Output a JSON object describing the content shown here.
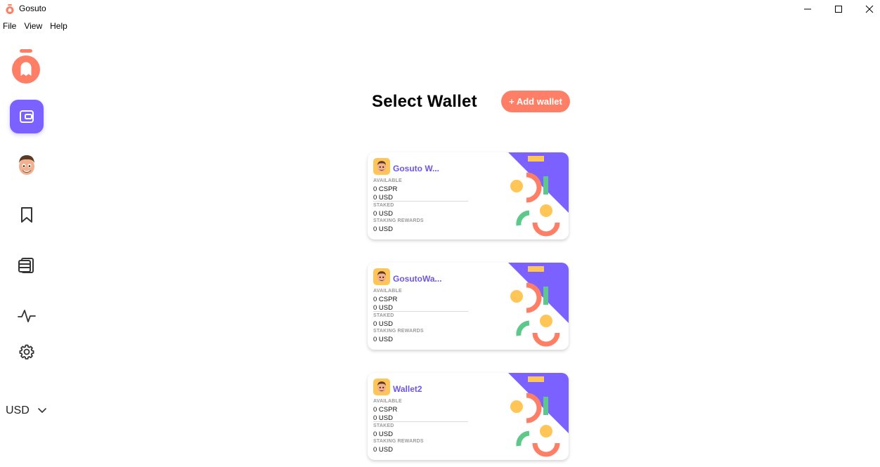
{
  "window": {
    "title": "Gosuto",
    "controls": [
      "minimize-icon",
      "maximize-icon",
      "close-icon"
    ]
  },
  "menu": {
    "file": "File",
    "view": "View",
    "help": "Help"
  },
  "sidebar": {
    "items": [
      {
        "name": "wallet",
        "icon": "wallet-icon",
        "active": true
      },
      {
        "name": "profile",
        "icon": "avatar",
        "active": false
      },
      {
        "name": "bookmark",
        "icon": "bookmark-icon",
        "active": false
      },
      {
        "name": "stack",
        "icon": "stack-icon",
        "active": false
      },
      {
        "name": "activity",
        "icon": "activity-icon",
        "active": false
      },
      {
        "name": "settings",
        "icon": "gear-icon",
        "active": false
      }
    ],
    "currency": "USD"
  },
  "main": {
    "title": "Select Wallet",
    "add_wallet_label": "+ Add wallet",
    "labels": {
      "available": "AVAILABLE",
      "staked": "STAKED",
      "staking_rewards": "STAKING REWARDS"
    },
    "wallets": [
      {
        "name": "Gosuto W...",
        "available_cspr": "0 CSPR",
        "available_usd": "0 USD",
        "staked": "0 USD",
        "rewards": "0 USD"
      },
      {
        "name": "GosutoWa...",
        "available_cspr": "0 CSPR",
        "available_usd": "0 USD",
        "staked": "0 USD",
        "rewards": "0 USD"
      },
      {
        "name": "Wallet2",
        "available_cspr": "0 CSPR",
        "available_usd": "0 USD",
        "staked": "0 USD",
        "rewards": "0 USD"
      }
    ]
  },
  "colors": {
    "brand": "#ff7f66",
    "accent": "#7b61ff",
    "name_text": "#6e56e6",
    "yellow": "#ffc657",
    "green": "#5cc98a"
  }
}
